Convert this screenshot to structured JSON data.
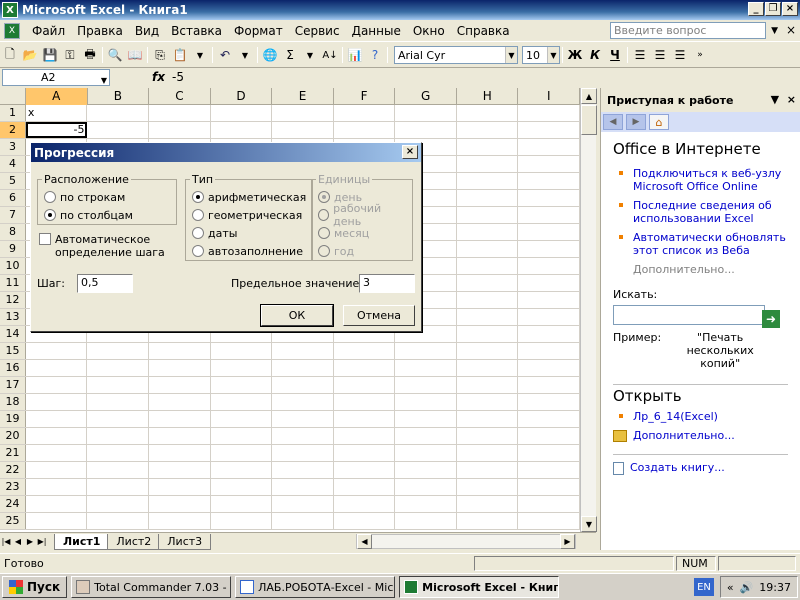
{
  "window": {
    "title": "Microsoft Excel - Книга1"
  },
  "menu": {
    "items": [
      "Файл",
      "Правка",
      "Вид",
      "Вставка",
      "Формат",
      "Сервис",
      "Данные",
      "Окно",
      "Справка"
    ],
    "help_placeholder": "Введите вопрос"
  },
  "toolbar": {
    "font_name": "Arial Cyr",
    "font_size": "10",
    "bold": "Ж",
    "italic": "К",
    "underline": "Ч"
  },
  "formula": {
    "name_box": "A2",
    "fx": "fx",
    "value": "-5"
  },
  "grid": {
    "columns": [
      "A",
      "B",
      "C",
      "D",
      "E",
      "F",
      "G",
      "H",
      "I"
    ],
    "rows": [
      "1",
      "2",
      "3",
      "4",
      "5",
      "6",
      "7",
      "8",
      "9",
      "10",
      "11",
      "12",
      "13",
      "14",
      "15",
      "16",
      "17",
      "18",
      "19",
      "20",
      "21",
      "22",
      "23",
      "24",
      "25"
    ],
    "a1": "x",
    "a2": "-5"
  },
  "sheets": [
    "Лист1",
    "Лист2",
    "Лист3"
  ],
  "status": {
    "text": "Готово",
    "num": "NUM"
  },
  "taskpane": {
    "title": "Приступая к работе",
    "office_heading": "Office в Интернете",
    "links": [
      "Подключиться к веб-узлу Microsoft Office Online",
      "Последние сведения об использовании Excel",
      "Автоматически обновлять этот список из Веба"
    ],
    "more": "Дополнительно...",
    "search_label": "Искать:",
    "example_label": "Пример:",
    "example_text": "\"Печать нескольких копий\"",
    "open_heading": "Открыть",
    "recent_file": "Лр_6_14(Excel)",
    "open_more": "Дополнительно...",
    "create": "Создать книгу..."
  },
  "dialog": {
    "title": "Прогрессия",
    "location_legend": "Расположение",
    "location_options": [
      "по строкам",
      "по столбцам"
    ],
    "location_selected": 1,
    "type_legend": "Тип",
    "type_options": [
      "арифметическая",
      "геометрическая",
      "даты",
      "автозаполнение"
    ],
    "type_selected": 0,
    "units_legend": "Единицы",
    "units_options": [
      "день",
      "рабочий день",
      "месяц",
      "год"
    ],
    "units_selected": 0,
    "auto_step": "Автоматическое определение шага",
    "step_label": "Шаг:",
    "step_value": "0,5",
    "limit_label": "Предельное значение:",
    "limit_value": "3",
    "ok": "ОК",
    "cancel": "Отмена"
  },
  "taskbar": {
    "start": "Пуск",
    "buttons": [
      "Total Commander 7.03 - ...",
      "ЛАБ.РОБОТА-Excel - Mic...",
      "Microsoft Excel - Книг..."
    ],
    "lang": "EN",
    "time": "19:37"
  },
  "colors": {
    "title_blue": "#0a246a",
    "selection_header": "#ffc66b",
    "link": "#0000cc"
  }
}
